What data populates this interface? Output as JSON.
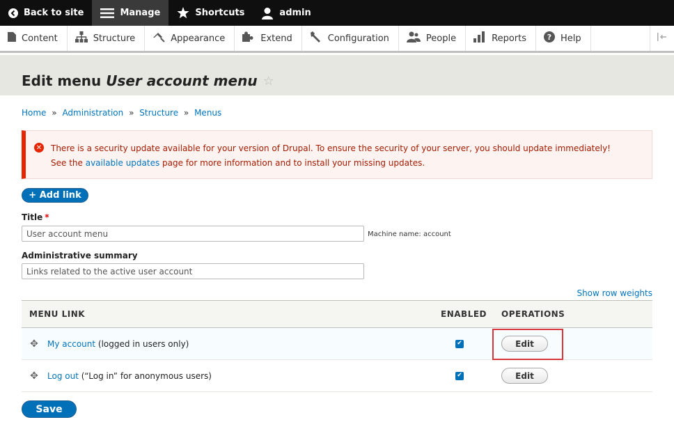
{
  "toolbar": {
    "back_to_site": "Back to site",
    "manage": "Manage",
    "shortcuts": "Shortcuts",
    "user": "admin"
  },
  "tray": {
    "items": [
      "Content",
      "Structure",
      "Appearance",
      "Extend",
      "Configuration",
      "People",
      "Reports",
      "Help"
    ]
  },
  "page": {
    "title_prefix": "Edit menu ",
    "title_name": "User account menu"
  },
  "breadcrumb": [
    "Home",
    "Administration",
    "Structure",
    "Menus"
  ],
  "breadcrumb_sep": "»",
  "message": {
    "line1": "There is a security update available for your version of Drupal. To ensure the security of your server, you should update immediately!",
    "line2_pre": "See the ",
    "line2_link": "available updates",
    "line2_post": " page for more information and to install your missing updates."
  },
  "form": {
    "add_link": "+ Add link",
    "title_label": "Title",
    "title_value": "User account menu",
    "machine_name": "Machine name: account",
    "summary_label": "Administrative summary",
    "summary_value": "Links related to the active user account",
    "show_row_weights": "Show row weights",
    "save": "Save"
  },
  "table": {
    "headers": [
      "MENU LINK",
      "ENABLED",
      "OPERATIONS"
    ],
    "rows": [
      {
        "link": "My account",
        "note": " (logged in users only)",
        "enabled": true,
        "op": "Edit"
      },
      {
        "link": "Log out",
        "note": " (“Log in” for anonymous users)",
        "enabled": true,
        "op": "Edit"
      }
    ]
  },
  "colors": {
    "accent": "#0071b8",
    "error": "#e62600",
    "toolbar_bg": "#0f0f0f"
  }
}
